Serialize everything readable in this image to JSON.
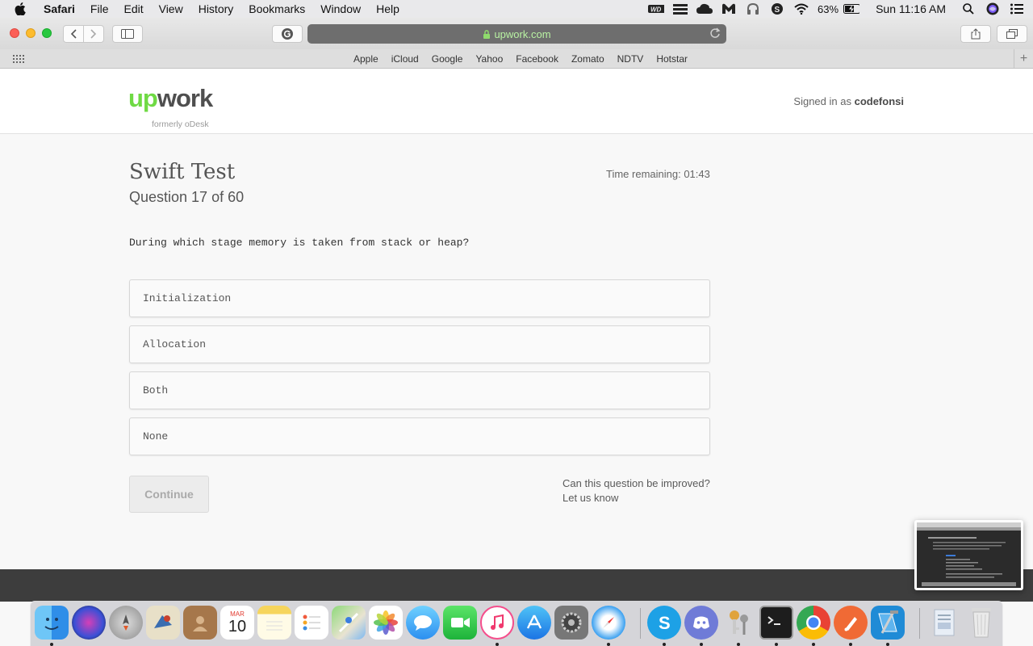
{
  "menubar": {
    "app_name": "Safari",
    "items": [
      "File",
      "Edit",
      "View",
      "History",
      "Bookmarks",
      "Window",
      "Help"
    ],
    "status_icons": [
      "wd-icon",
      "menu-icon",
      "cloud-icon",
      "malwarebytes-icon",
      "headphones-icon",
      "skype-status-icon",
      "wifi-icon"
    ],
    "battery": "63%",
    "clock": "Sun 11:16 AM"
  },
  "toolbar": {
    "url": "upwork.com"
  },
  "favorites": [
    "Apple",
    "iCloud",
    "Google",
    "Yahoo",
    "Facebook",
    "Zomato",
    "NDTV",
    "Hotstar"
  ],
  "header": {
    "logo_up": "up",
    "logo_work": "work",
    "logo_sub": "formerly oDesk",
    "signed_in_prefix": "Signed in as",
    "username": "codefonsi"
  },
  "test": {
    "title": "Swift Test",
    "question_count": "Question 17 of 60",
    "timer": "Time remaining: 01:43",
    "question": "During which stage memory is taken from stack or heap?",
    "options": [
      "Initialization",
      "Allocation",
      "Both",
      "None"
    ],
    "continue_label": "Continue",
    "improve_line1": "Can this question be improved?",
    "improve_line2": "Let us know"
  },
  "dock": {
    "apps": [
      "Finder",
      "Siri",
      "Launchpad",
      "Mail",
      "Contacts",
      "Calendar",
      "Notes",
      "Reminders",
      "Maps",
      "Photos",
      "Messages",
      "FaceTime",
      "iTunes",
      "App Store",
      "System Preferences",
      "Safari",
      "Skype",
      "Discord",
      "Keychain Access",
      "Terminal",
      "Chrome",
      "Paw",
      "Xcode",
      "Downloads",
      "Trash"
    ],
    "calendar_month": "MAR",
    "calendar_day": "10"
  },
  "colors": {
    "brand_green": "#6fda44",
    "url_text": "#b9f2a3"
  }
}
